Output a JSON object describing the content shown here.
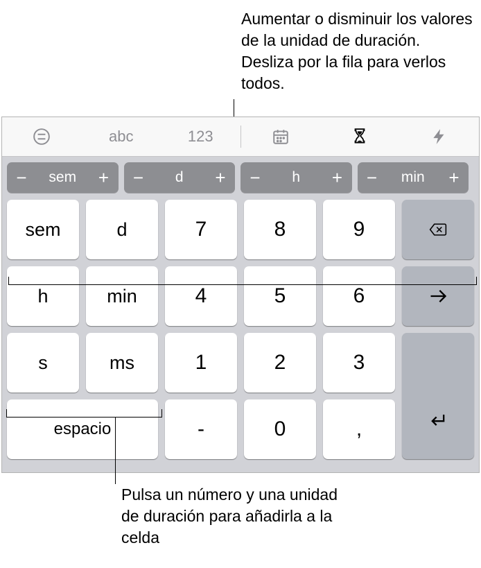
{
  "annotations": {
    "top": "Aumentar o disminuir los valores de la unidad de duración. Desliza por la fila para verlos todos.",
    "bottom": "Pulsa un número y una unidad de duración para añadirla a la celda"
  },
  "toolbar": {
    "abc": "abc",
    "numbers": "123"
  },
  "steppers": {
    "minus": "−",
    "plus": "+",
    "items": [
      "sem",
      "d",
      "h",
      "min"
    ]
  },
  "keys": {
    "unit_sem": "sem",
    "unit_d": "d",
    "n7": "7",
    "n8": "8",
    "n9": "9",
    "unit_h": "h",
    "unit_min": "min",
    "n4": "4",
    "n5": "5",
    "n6": "6",
    "unit_s": "s",
    "unit_ms": "ms",
    "n1": "1",
    "n2": "2",
    "n3": "3",
    "space": "espacio",
    "dash": "-",
    "n0": "0",
    "comma": ","
  }
}
